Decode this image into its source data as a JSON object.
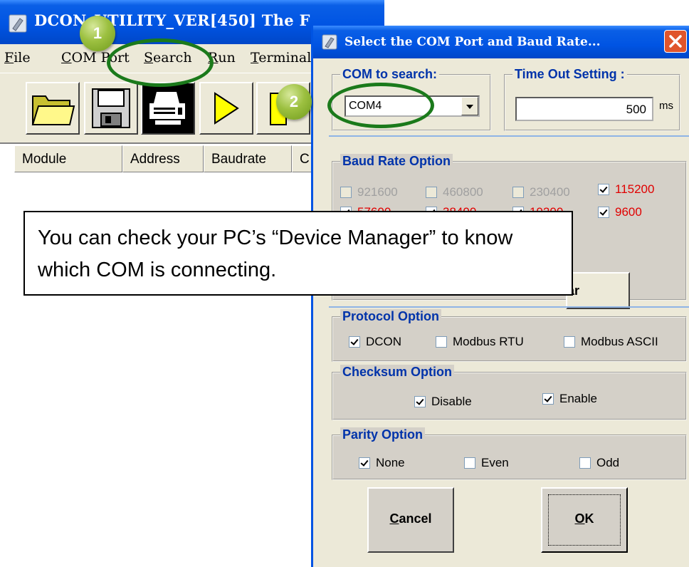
{
  "main_window": {
    "title": "DCON_UTILITY_VER[450] The F",
    "menu": [
      {
        "underline": "F",
        "rest": "ile"
      },
      {
        "underline": "C",
        "rest": "OM Port"
      },
      {
        "underline": "S",
        "rest": "earch"
      },
      {
        "underline": "R",
        "rest": "un"
      },
      {
        "underline": "T",
        "rest": "erminal"
      }
    ],
    "toolbar_icons": [
      "folder-open-icon",
      "save-disk-icon",
      "printer-icon",
      "play-icon",
      "stop-icon"
    ],
    "columns": [
      "Module",
      "Address",
      "Baudrate",
      "C"
    ]
  },
  "dialog": {
    "title": "Select the COM Port and Baud Rate...",
    "com_group": {
      "legend": "COM to search:",
      "value": "COM4"
    },
    "timeout_group": {
      "legend": "Time Out Setting :",
      "value": "500",
      "unit": "ms"
    },
    "baud_group": {
      "legend": "Baud Rate Option",
      "options": [
        {
          "label": "921600",
          "checked": false,
          "state": "disabled"
        },
        {
          "label": "460800",
          "checked": false,
          "state": "disabled"
        },
        {
          "label": "230400",
          "checked": false,
          "state": "disabled"
        },
        {
          "label": "115200",
          "checked": true,
          "state": "red"
        },
        {
          "label": "57600",
          "checked": true,
          "state": "red"
        },
        {
          "label": "38400",
          "checked": true,
          "state": "red"
        },
        {
          "label": "19200",
          "checked": true,
          "state": "red"
        },
        {
          "label": "9600",
          "checked": true,
          "state": "red"
        }
      ],
      "partial_button_label": "ar"
    },
    "protocol_group": {
      "legend": "Protocol Option",
      "options": [
        {
          "label": "DCON",
          "checked": true
        },
        {
          "label": "Modbus RTU",
          "checked": false
        },
        {
          "label": "Modbus ASCII",
          "checked": false
        }
      ]
    },
    "checksum_group": {
      "legend": "Checksum  Option",
      "options": [
        {
          "label": "Disable",
          "checked": true
        },
        {
          "label": "Enable",
          "checked": true
        }
      ]
    },
    "parity_group": {
      "legend": "Parity Option",
      "options": [
        {
          "label": "None",
          "checked": true
        },
        {
          "label": "Even",
          "checked": false
        },
        {
          "label": "Odd",
          "checked": false
        }
      ]
    },
    "cancel": {
      "accel": "C",
      "rest": "ancel"
    },
    "ok": {
      "accel": "O",
      "rest": "K"
    }
  },
  "annotations": {
    "callout_text": "You can check your PC’s “Device Manager” to know which COM is connecting.",
    "badges": [
      "1",
      "2"
    ],
    "accent_color": "#1b7a1b"
  }
}
